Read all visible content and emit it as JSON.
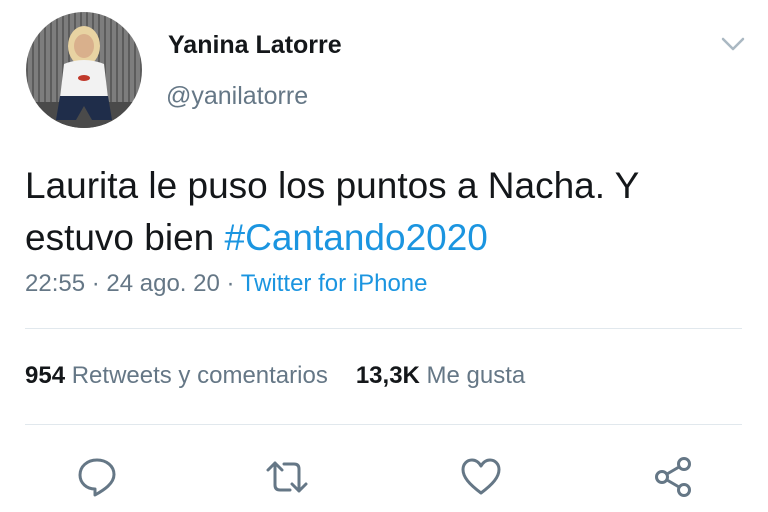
{
  "user": {
    "display_name": "Yanina Latorre",
    "handle": "@yanilatorre",
    "avatar_icon": "profile-photo"
  },
  "tweet": {
    "text_plain": "Laurita le puso los puntos a Nacha. Y estuvo bien ",
    "hashtag": "#Cantando2020",
    "time": "22:55",
    "date": "24 ago. 20",
    "separator": " · ",
    "source": "Twitter for iPhone"
  },
  "stats": {
    "retweets_count": "954",
    "retweets_label": "Retweets y comentarios",
    "likes_count": "13,3K",
    "likes_label": "Me gusta"
  },
  "actions": {
    "reply_icon": "speech-bubble-icon",
    "retweet_icon": "retweet-arrows-icon",
    "like_icon": "heart-icon",
    "share_icon": "share-nodes-icon"
  },
  "colors": {
    "text": "#14171a",
    "secondary": "#657786",
    "link": "#1b95e0",
    "divider": "#e1e8ed"
  }
}
